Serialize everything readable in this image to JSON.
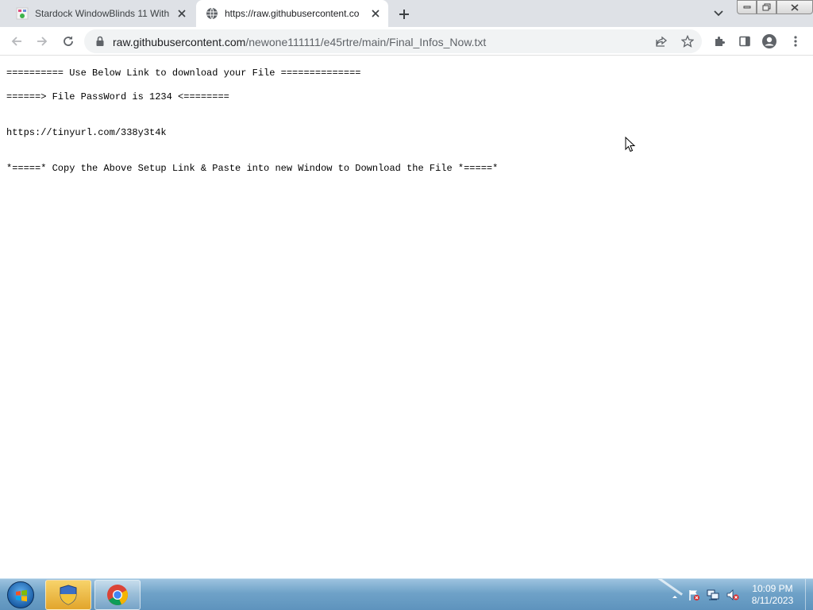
{
  "browser": {
    "tabs": [
      {
        "title": "Stardock WindowBlinds 11 With",
        "favicon": "site-favicon",
        "active": false
      },
      {
        "title": "https://raw.githubusercontent.co",
        "favicon": "globe-icon",
        "active": true
      }
    ],
    "address": {
      "host": "raw.githubusercontent.com",
      "path": "/newone111111/e45rtre/main/Final_Infos_Now.txt"
    }
  },
  "document": {
    "lines": [
      "========== Use Below Link to download your File ==============",
      "======> File PassWord is 1234 <========",
      "https://tinyurl.com/338y3t4k",
      "*=====* Copy the Above Setup Link & Paste into new Window to Download the File *=====*"
    ]
  },
  "taskbar": {
    "clock_time": "10:09 PM",
    "clock_date": "8/11/2023",
    "pinned": [
      "security-shield-icon",
      "chrome-icon"
    ]
  }
}
